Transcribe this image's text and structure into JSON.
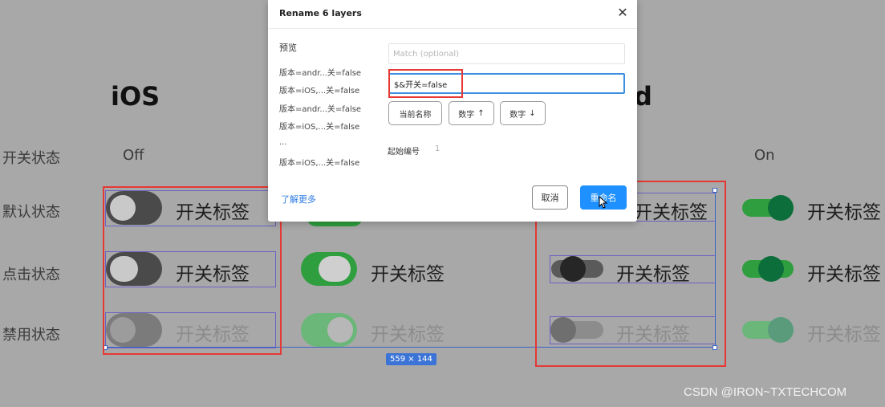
{
  "canvas": {
    "ios_title": "iOS",
    "android_title_fragment": "d",
    "column_off": "Off",
    "column_on": "On",
    "row_labels": [
      "开关状态",
      "默认状态",
      "点击状态",
      "禁用状态"
    ],
    "tag_label": "开关标签",
    "selection_size": "559 × 144"
  },
  "colors": {
    "ios_off_track": "#4a4a4a",
    "ios_on_track": "#2e9e3e",
    "android_on_track": "#2e9e3e",
    "android_on_knob": "#0c6e3a",
    "android_off_knob": "#262626",
    "annotation_red": "#e53935",
    "selection_blue": "#3b66c4",
    "primary_button": "#1e90ff"
  },
  "dialog": {
    "title": "Rename 6 layers",
    "close_icon": "close-icon",
    "preview_heading": "预览",
    "preview_items": [
      "版本=andr...关=false",
      "版本=iOS,...关=false",
      "版本=andr...关=false",
      "版本=iOS,...关=false",
      "...",
      "版本=iOS,...关=false"
    ],
    "match_placeholder": "Match (optional)",
    "rename_value": "$&开关=false",
    "chips": {
      "current_name": "当前名称",
      "number_asc": "数字",
      "number_desc": "数字"
    },
    "start_number_label": "起始编号",
    "start_number_value": "1",
    "learn_more": "了解更多",
    "cancel": "取消",
    "rename": "重命名"
  },
  "watermark": "CSDN @IRON~TXTECHCOM"
}
